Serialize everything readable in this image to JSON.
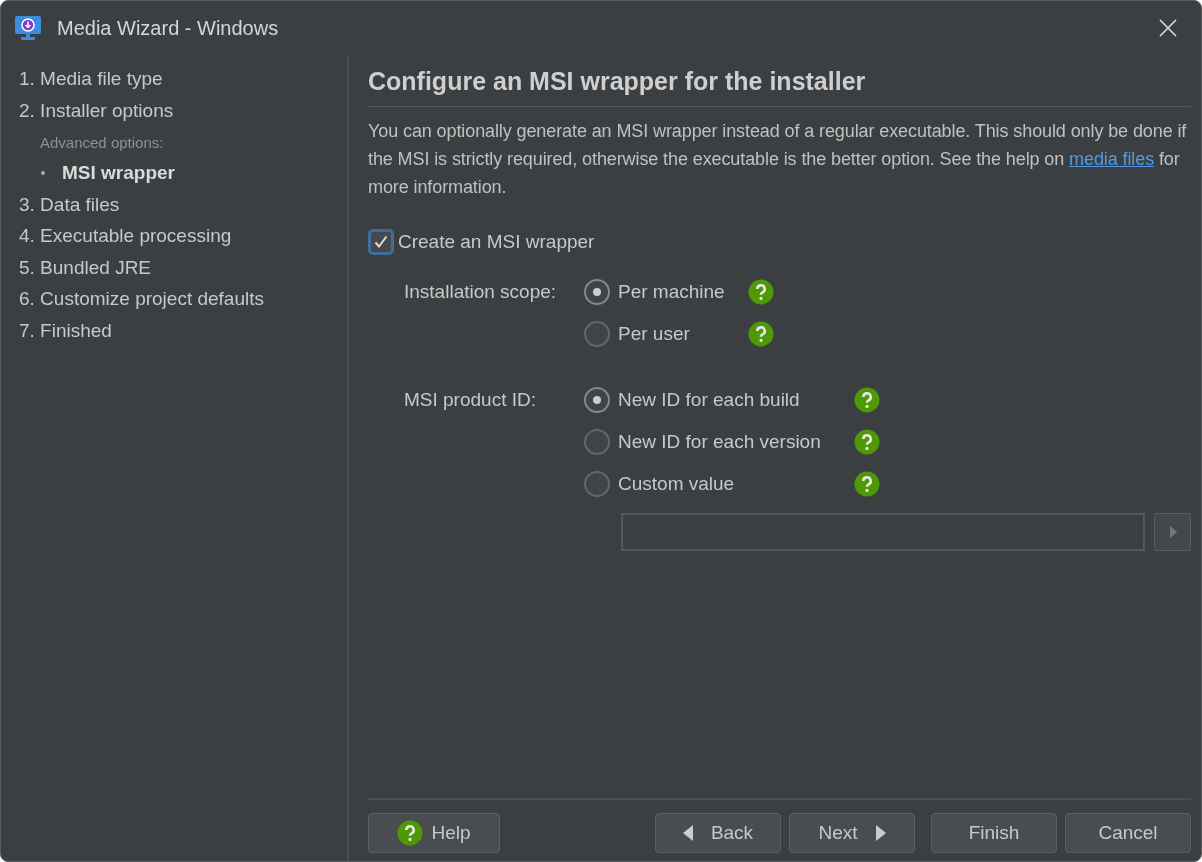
{
  "window": {
    "title": "Media Wizard - Windows"
  },
  "steps": [
    {
      "label": "1. Media file type",
      "selected": false
    },
    {
      "label": "2. Installer options",
      "selected": false,
      "sub_heading": "Advanced options:",
      "children": [
        {
          "label": "MSI wrapper",
          "selected": true
        }
      ]
    },
    {
      "label": "3. Data files",
      "selected": false
    },
    {
      "label": "4. Executable processing",
      "selected": false
    },
    {
      "label": "5. Bundled JRE",
      "selected": false
    },
    {
      "label": "6. Customize project defaults",
      "selected": false
    },
    {
      "label": "7. Finished",
      "selected": false
    }
  ],
  "page": {
    "heading": "Configure an MSI wrapper for the installer",
    "intro_before": "You can optionally generate an MSI wrapper instead of a regular executable. This should only be done if the MSI is strictly required, otherwise the executable is the better option. See the help on",
    "intro_link": "media files",
    "intro_after": "for more information.",
    "checkbox": {
      "label": "Create an MSI wrapper",
      "checked": true
    },
    "groups": [
      {
        "label": "Installation scope:",
        "options": [
          {
            "label": "Per machine",
            "selected": true
          },
          {
            "label": "Per user",
            "selected": false
          }
        ]
      },
      {
        "label": "MSI product ID:",
        "options": [
          {
            "label": "New ID for each build",
            "selected": true
          },
          {
            "label": "New ID for each version",
            "selected": false
          },
          {
            "label": "Custom value",
            "selected": false
          }
        ]
      }
    ]
  },
  "buttons": {
    "help": "Help",
    "back": "Back",
    "next": "Next",
    "finish": "Finish",
    "cancel": "Cancel"
  }
}
